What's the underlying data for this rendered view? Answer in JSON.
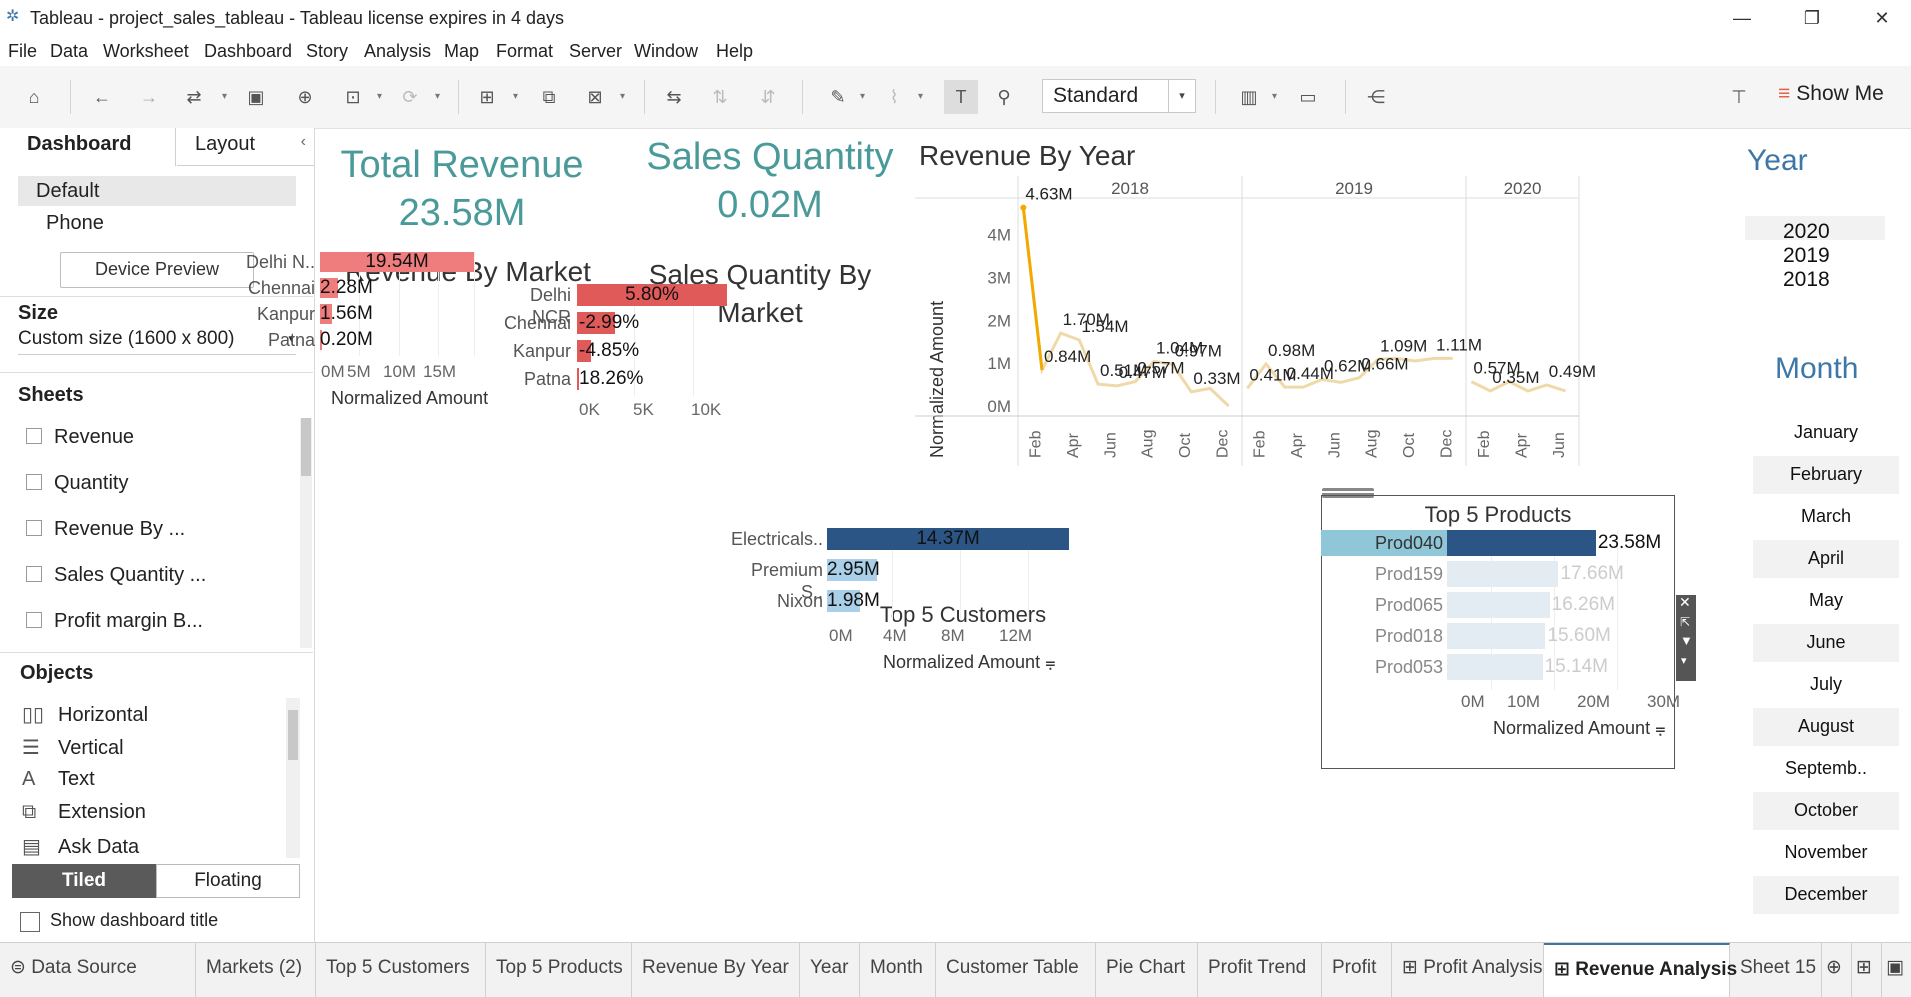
{
  "window": {
    "title": "Tableau - project_sales_tableau - Tableau license expires in 4 days",
    "minimize": "—",
    "restore": "❐",
    "close": "✕"
  },
  "menu": [
    "File",
    "Data",
    "Worksheet",
    "Dashboard",
    "Story",
    "Analysis",
    "Map",
    "Format",
    "Server",
    "Window",
    "Help"
  ],
  "toolbar": {
    "fit": "Standard",
    "show_me": "Show Me"
  },
  "left_panel": {
    "tabs": {
      "dashboard": "Dashboard",
      "layout": "Layout"
    },
    "devices": {
      "default": "Default",
      "phone": "Phone",
      "preview_button": "Device Preview"
    },
    "size": {
      "header": "Size",
      "value": "Custom size (1600 x 800)"
    },
    "sheets": {
      "header": "Sheets",
      "items": [
        "Revenue",
        "Quantity",
        "Revenue By ...",
        "Sales Quantity ...",
        "Profit margin B..."
      ]
    },
    "objects": {
      "header": "Objects",
      "items": [
        "Horizontal",
        "Vertical",
        "Text",
        "Extension",
        "Ask Data"
      ]
    },
    "layout_mode": {
      "tiled": "Tiled",
      "floating": "Floating"
    },
    "show_title": "Show dashboard title"
  },
  "kpis": {
    "total_revenue": {
      "title": "Total Revenue",
      "value": "23.58M"
    },
    "sales_quantity": {
      "title": "Sales Quantity",
      "value": "0.02M"
    }
  },
  "filters": {
    "year": {
      "title": "Year",
      "items": [
        "2020",
        "2019",
        "2018"
      ]
    },
    "month": {
      "title": "Month",
      "items": [
        "January",
        "February",
        "March",
        "April",
        "May",
        "June",
        "July",
        "August",
        "Septemb..",
        "October",
        "November",
        "December"
      ]
    }
  },
  "sheet_tabs": [
    "Data Source",
    "Markets (2)",
    "Top 5 Customers",
    "Top 5 Products",
    "Revenue By Year",
    "Year",
    "Month",
    "Customer Table",
    "Pie Chart",
    "Profit Trend",
    "Profit",
    "Profit Analysis",
    "Revenue Analysis",
    "Sheet 15"
  ],
  "colors": {
    "accent": "#4a9a9a",
    "revenue_bar": "#f07d7d",
    "quantity_bar": "#e05a5a",
    "customer_bar_dark": "#2b5585",
    "customer_bar_light": "#a9cfe9",
    "line": "#f0d9a8",
    "line_highlight": "#f2a900"
  },
  "chart_data": [
    {
      "type": "bar",
      "title": "Revenue By Market",
      "categories": [
        "Delhi N..",
        "Chennai",
        "Kanpur",
        "Patna"
      ],
      "values": [
        19.54,
        2.28,
        1.56,
        0.2
      ],
      "labels": [
        "19.54M",
        "2.28M",
        "1.56M",
        "0.20M"
      ],
      "xlabel": "Normalized Amount",
      "ticks": [
        "0M",
        "5M",
        "10M",
        "15M"
      ],
      "xlim": [
        0,
        19.54
      ]
    },
    {
      "type": "bar",
      "title": "Sales Quantity By Market",
      "categories": [
        "Delhi NCR",
        "Chennai",
        "Kanpur",
        "Patna"
      ],
      "values": [
        13000,
        3300,
        1200,
        200
      ],
      "labels": [
        "5.80%",
        "-2.99%",
        "-4.85%",
        "18.26%"
      ],
      "ticks": [
        "0K",
        "5K",
        "10K"
      ],
      "xlim": [
        0,
        13000
      ]
    },
    {
      "type": "line",
      "title": "Revenue By Year",
      "ylabel": "Normalized Amount",
      "years": [
        "2018",
        "2019",
        "2020"
      ],
      "yticks": [
        "0M",
        "1M",
        "2M",
        "3M",
        "4M"
      ],
      "ylim": [
        0,
        4.9
      ],
      "series": [
        {
          "x": [
            "Jan",
            "Feb",
            "Mar",
            "Apr",
            "May",
            "Jun",
            "Jul",
            "Aug",
            "Sep",
            "Oct",
            "Nov",
            "Dec"
          ],
          "values": [
            4.63,
            0.84,
            1.7,
            1.54,
            0.51,
            0.47,
            0.57,
            1.04,
            0.97,
            0.33,
            0.41,
            0.0
          ]
        },
        {
          "x": [
            "Jan",
            "Feb",
            "Mar",
            "Apr",
            "May",
            "Jun",
            "Jul",
            "Aug",
            "Sep",
            "Oct",
            "Nov",
            "Dec"
          ],
          "values": [
            0.41,
            0.98,
            0.44,
            0.44,
            0.62,
            0.55,
            0.66,
            1.09,
            1.11,
            1.05,
            1.11,
            1.11
          ]
        },
        {
          "x": [
            "Jan",
            "Feb",
            "Mar",
            "Apr",
            "May",
            "Jun"
          ],
          "values": [
            0.57,
            0.35,
            0.57,
            0.35,
            0.49,
            0.35
          ]
        }
      ],
      "xticks": {
        "2018": [
          "Feb",
          "Apr",
          "Jun",
          "Aug",
          "Oct",
          "Dec"
        ],
        "2019": [
          "Feb",
          "Apr",
          "Jun",
          "Aug",
          "Oct",
          "Dec"
        ],
        "2020": [
          "Feb",
          "Apr",
          "Jun"
        ]
      },
      "labels": [
        {
          "text": "4.63M"
        },
        {
          "text": "1.70M"
        },
        {
          "text": "0.84M"
        },
        {
          "text": "1.54M"
        },
        {
          "text": "0.51M"
        },
        {
          "text": "0.47M"
        },
        {
          "text": "1.04M"
        },
        {
          "text": "0.57M"
        },
        {
          "text": "0.97M"
        },
        {
          "text": "0.33M"
        },
        {
          "text": "0.41M"
        },
        {
          "text": "0.98M"
        },
        {
          "text": "0.44M"
        },
        {
          "text": "0.62M"
        },
        {
          "text": "1.09M"
        },
        {
          "text": "1.11M"
        },
        {
          "text": "0.66M"
        },
        {
          "text": "0.57M"
        },
        {
          "text": "0.35M"
        },
        {
          "text": "0.49M"
        }
      ]
    },
    {
      "type": "bar",
      "title": "Top 5 Customers",
      "categories": [
        "Electricals..",
        "Premium S..",
        "Nixon"
      ],
      "values": [
        14.37,
        2.95,
        1.98
      ],
      "labels": [
        "14.37M",
        "2.95M",
        "1.98M"
      ],
      "xlabel": "Normalized Amount",
      "ticks": [
        "0M",
        "4M",
        "8M",
        "12M"
      ],
      "xlim": [
        0,
        14.37
      ]
    },
    {
      "type": "bar",
      "title": "Top 5 Products",
      "categories": [
        "Prod040",
        "Prod159",
        "Prod065",
        "Prod018",
        "Prod053"
      ],
      "values": [
        23.58,
        17.66,
        16.26,
        15.6,
        15.14
      ],
      "labels": [
        "23.58M",
        "17.66M",
        "16.26M",
        "15.60M",
        "15.14M"
      ],
      "xlabel": "Normalized Amount",
      "ticks": [
        "0M",
        "10M",
        "20M",
        "30M"
      ],
      "xlim": [
        0,
        32
      ]
    }
  ]
}
